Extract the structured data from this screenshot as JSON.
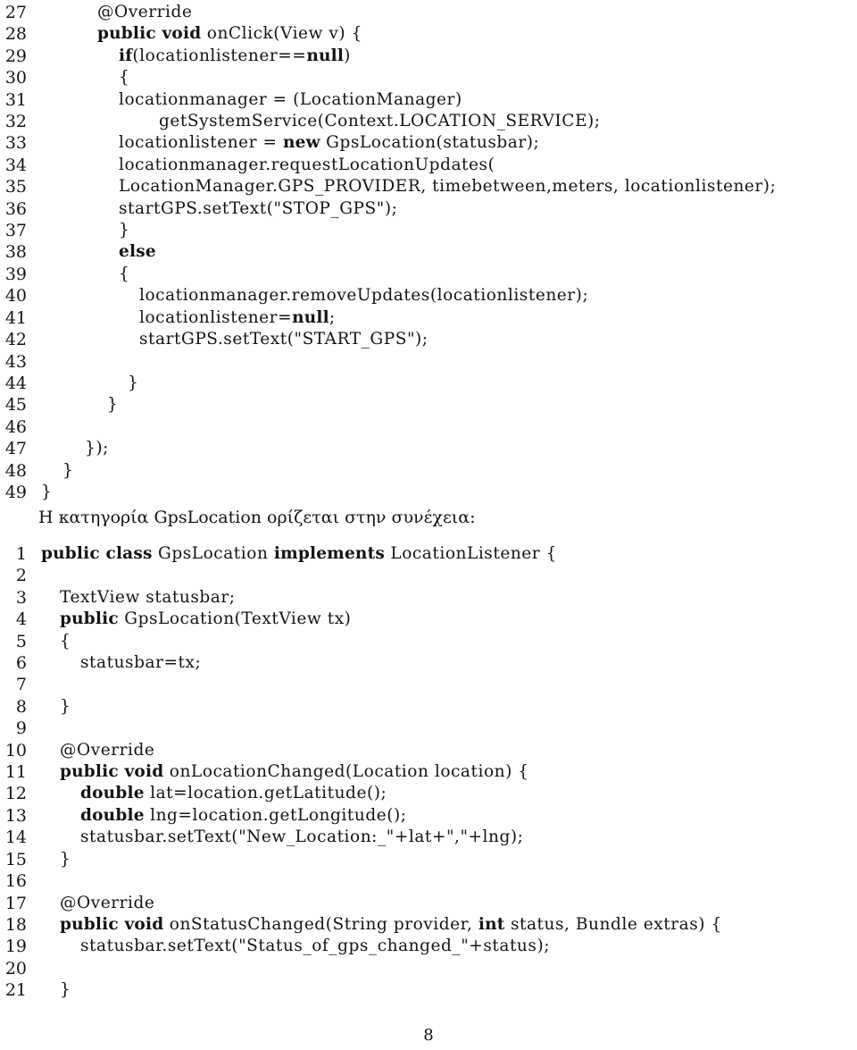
{
  "document": {
    "page_number": "8",
    "language": "el",
    "listings": [
      {
        "id": "listing-onclick",
        "first_line_number": 27,
        "lines": [
          {
            "num": "27",
            "indent": 66,
            "segments": [
              {
                "t": "@Override",
                "b": false
              }
            ]
          },
          {
            "num": "28",
            "indent": 66,
            "segments": [
              {
                "t": "public void",
                "b": true
              },
              {
                "t": " onClick(View v) {",
                "b": false
              }
            ]
          },
          {
            "num": "29",
            "indent": 90,
            "segments": [
              {
                "t": "if",
                "b": true
              },
              {
                "t": "(locationlistener==",
                "b": false
              },
              {
                "t": "null",
                "b": true
              },
              {
                "t": ")",
                "b": false
              }
            ]
          },
          {
            "num": "30",
            "indent": 90,
            "segments": [
              {
                "t": "{",
                "b": false
              }
            ]
          },
          {
            "num": "31",
            "indent": 90,
            "segments": [
              {
                "t": "locationmanager = (LocationManager)",
                "b": false
              }
            ]
          },
          {
            "num": "32",
            "indent": 135,
            "segments": [
              {
                "t": "getSystemService(Context.LOCATION_SERVICE);",
                "b": false
              }
            ]
          },
          {
            "num": "33",
            "indent": 90,
            "segments": [
              {
                "t": "locationlistener = ",
                "b": false
              },
              {
                "t": "new",
                "b": true
              },
              {
                "t": " GpsLocation(statusbar);",
                "b": false
              }
            ]
          },
          {
            "num": "34",
            "indent": 90,
            "segments": [
              {
                "t": "locationmanager.requestLocationUpdates(",
                "b": false
              }
            ]
          },
          {
            "num": "35",
            "indent": 90,
            "segments": [
              {
                "t": "LocationManager.GPS_PROVIDER, timebetween,meters, locationlistener);",
                "b": false
              }
            ]
          },
          {
            "num": "36",
            "indent": 90,
            "segments": [
              {
                "t": "startGPS.setText(\"STOP_GPS\");",
                "b": false
              }
            ]
          },
          {
            "num": "37",
            "indent": 90,
            "segments": [
              {
                "t": "}",
                "b": false
              }
            ]
          },
          {
            "num": "38",
            "indent": 90,
            "segments": [
              {
                "t": "else",
                "b": true
              }
            ]
          },
          {
            "num": "39",
            "indent": 90,
            "segments": [
              {
                "t": "{",
                "b": false
              }
            ]
          },
          {
            "num": "40",
            "indent": 113,
            "segments": [
              {
                "t": "locationmanager.removeUpdates(locationlistener);",
                "b": false
              }
            ]
          },
          {
            "num": "41",
            "indent": 113,
            "segments": [
              {
                "t": "locationlistener=",
                "b": false
              },
              {
                "t": "null",
                "b": true
              },
              {
                "t": ";",
                "b": false
              }
            ]
          },
          {
            "num": "42",
            "indent": 113,
            "segments": [
              {
                "t": "startGPS.setText(\"START_GPS\");",
                "b": false
              }
            ]
          },
          {
            "num": "43",
            "indent": 90,
            "segments": [
              {
                "t": "",
                "b": false
              }
            ]
          },
          {
            "num": "44",
            "indent": 100,
            "segments": [
              {
                "t": "}",
                "b": false
              }
            ]
          },
          {
            "num": "45",
            "indent": 77,
            "segments": [
              {
                "t": "}",
                "b": false
              }
            ]
          },
          {
            "num": "46",
            "indent": 55,
            "segments": [
              {
                "t": "",
                "b": false
              }
            ]
          },
          {
            "num": "47",
            "indent": 52,
            "segments": [
              {
                "t": "});",
                "b": false
              }
            ]
          },
          {
            "num": "48",
            "indent": 27,
            "segments": [
              {
                "t": "}",
                "b": false
              }
            ]
          },
          {
            "num": "49",
            "indent": 3,
            "segments": [
              {
                "t": "}",
                "b": false
              }
            ]
          }
        ]
      },
      {
        "id": "listing-gpslocation",
        "first_line_number": 1,
        "lines": [
          {
            "num": "1",
            "indent": 3,
            "segments": [
              {
                "t": "public class",
                "b": true
              },
              {
                "t": " GpsLocation ",
                "b": false
              },
              {
                "t": "implements",
                "b": true
              },
              {
                "t": " LocationListener {",
                "b": false
              }
            ]
          },
          {
            "num": "2",
            "indent": 3,
            "segments": [
              {
                "t": "",
                "b": false
              }
            ]
          },
          {
            "num": "3",
            "indent": 24,
            "segments": [
              {
                "t": "TextView statusbar;",
                "b": false
              }
            ]
          },
          {
            "num": "4",
            "indent": 24,
            "segments": [
              {
                "t": "public",
                "b": true
              },
              {
                "t": " GpsLocation(TextView tx)",
                "b": false
              }
            ]
          },
          {
            "num": "5",
            "indent": 24,
            "segments": [
              {
                "t": "{",
                "b": false
              }
            ]
          },
          {
            "num": "6",
            "indent": 47,
            "segments": [
              {
                "t": "statusbar=tx;",
                "b": false
              }
            ]
          },
          {
            "num": "7",
            "indent": 24,
            "segments": [
              {
                "t": "",
                "b": false
              }
            ]
          },
          {
            "num": "8",
            "indent": 24,
            "segments": [
              {
                "t": "}",
                "b": false
              }
            ]
          },
          {
            "num": "9",
            "indent": 24,
            "segments": [
              {
                "t": "",
                "b": false
              }
            ]
          },
          {
            "num": "10",
            "indent": 24,
            "segments": [
              {
                "t": "@Override",
                "b": false
              }
            ]
          },
          {
            "num": "11",
            "indent": 24,
            "segments": [
              {
                "t": "public void",
                "b": true
              },
              {
                "t": " onLocationChanged(Location location) {",
                "b": false
              }
            ]
          },
          {
            "num": "12",
            "indent": 47,
            "segments": [
              {
                "t": "double",
                "b": true
              },
              {
                "t": " lat=location.getLatitude();",
                "b": false
              }
            ]
          },
          {
            "num": "13",
            "indent": 47,
            "segments": [
              {
                "t": "double",
                "b": true
              },
              {
                "t": " lng=location.getLongitude();",
                "b": false
              }
            ]
          },
          {
            "num": "14",
            "indent": 47,
            "segments": [
              {
                "t": "statusbar.setText(\"New_Location:_\"+lat+\",\"+lng);",
                "b": false
              }
            ]
          },
          {
            "num": "15",
            "indent": 24,
            "segments": [
              {
                "t": "}",
                "b": false
              }
            ]
          },
          {
            "num": "16",
            "indent": 24,
            "segments": [
              {
                "t": "",
                "b": false
              }
            ]
          },
          {
            "num": "17",
            "indent": 24,
            "segments": [
              {
                "t": "@Override",
                "b": false
              }
            ]
          },
          {
            "num": "18",
            "indent": 24,
            "segments": [
              {
                "t": "public void",
                "b": true
              },
              {
                "t": " onStatusChanged(String provider, ",
                "b": false
              },
              {
                "t": "int",
                "b": true
              },
              {
                "t": " status, Bundle extras) {",
                "b": false
              }
            ]
          },
          {
            "num": "19",
            "indent": 47,
            "segments": [
              {
                "t": "statusbar.setText(\"Status_of_gps_changed_\"+status);",
                "b": false
              }
            ]
          },
          {
            "num": "20",
            "indent": 24,
            "segments": [
              {
                "t": "",
                "b": false
              }
            ]
          },
          {
            "num": "21",
            "indent": 24,
            "segments": [
              {
                "t": "}",
                "b": false
              }
            ]
          }
        ]
      }
    ],
    "paragraph": {
      "text": "Η κατηγορία GpsLocation ορίζεται στην συνέχεια:"
    }
  }
}
